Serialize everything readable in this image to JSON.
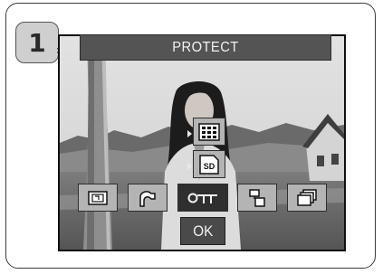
{
  "step": {
    "number": "1"
  },
  "screen": {
    "title": "PROTECT",
    "ok_label": "OK"
  },
  "protect_submenu": [
    {
      "icon": "all-frames-grid-icon"
    },
    {
      "icon": "sd-card-icon",
      "label": "SD"
    }
  ],
  "menu_bar": [
    {
      "icon": "rotate-image-icon"
    },
    {
      "icon": "slideshow-icon"
    },
    {
      "icon": "protect-key-icon",
      "label": "O-π",
      "selected": true
    },
    {
      "icon": "copy-icon"
    },
    {
      "icon": "print-order-icon"
    }
  ],
  "colors": {
    "button_gray": "#b4b4b4",
    "selected_dark": "#2f2f2f",
    "title_bar": "#545454"
  }
}
